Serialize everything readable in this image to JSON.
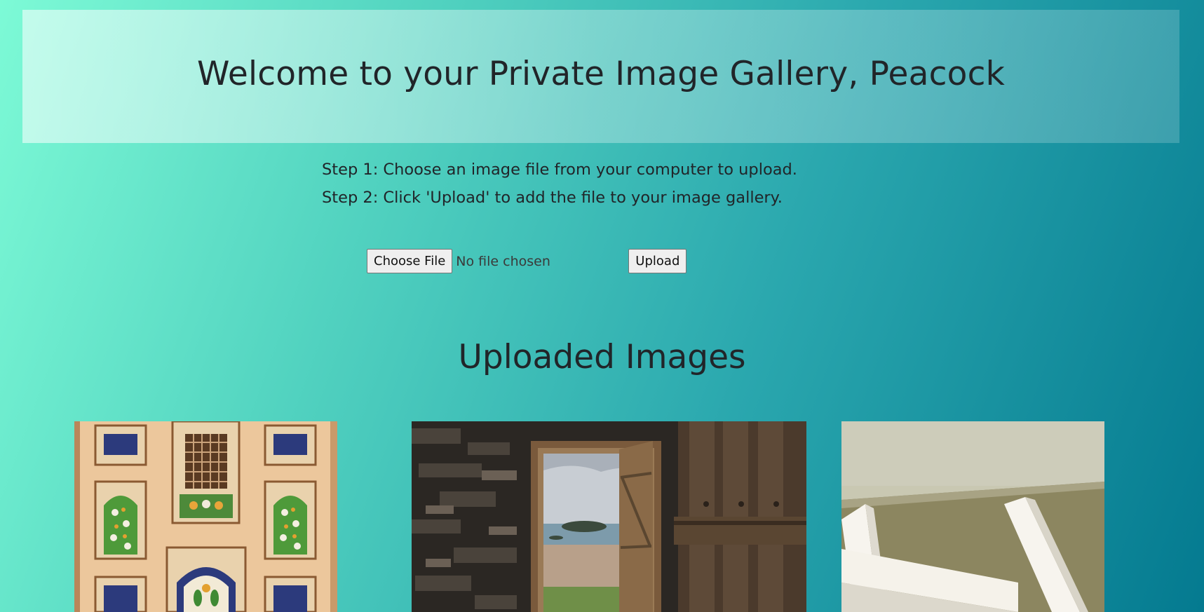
{
  "header": {
    "title": "Welcome to your Private Image Gallery, Peacock"
  },
  "instructions": {
    "step1": "Step 1: Choose an image file from your computer to upload.",
    "step2": "Step 2: Click 'Upload' to add the file to your image gallery."
  },
  "upload": {
    "choose_label": "Choose File",
    "file_status": "No file chosen",
    "upload_label": "Upload"
  },
  "gallery": {
    "title": "Uploaded Images",
    "images": [
      {
        "subject": "ornate tiled wall with floral arches"
      },
      {
        "subject": "open wooden door onto a beach and island"
      },
      {
        "subject": "white angular beams against an olive wall"
      }
    ]
  }
}
